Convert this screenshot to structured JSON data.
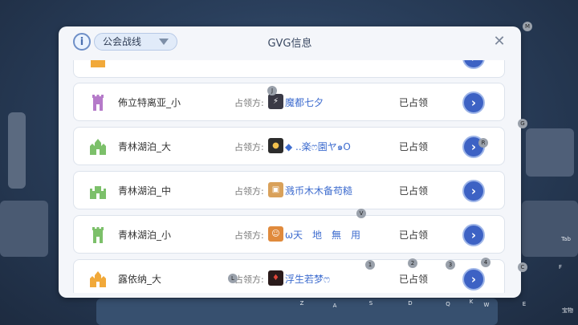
{
  "header": {
    "info_icon": "i",
    "dropdown_label": "公会战线",
    "title": "GVG信息",
    "close_icon": "✕"
  },
  "rows": [
    {
      "name": "",
      "occupier_label": "",
      "guild": "",
      "status": "",
      "castle_color": "#f1a93a",
      "emblem_color": "#f2c14e"
    },
    {
      "name": "佈立特离亚_小",
      "occupier_label": "占领方:",
      "guild": "魔都七夕",
      "status": "已占领",
      "castle_color": "#b57ac9",
      "emblem_color": "#3a3a46"
    },
    {
      "name": "青林湖泊_大",
      "occupier_label": "占领方:",
      "guild": "◆ ..楽ෆ園ヤ๑O",
      "status": "已占领",
      "castle_color": "#7cc06a",
      "emblem_color": "#2c2c2c"
    },
    {
      "name": "青林湖泊_中",
      "occupier_label": "占领方:",
      "guild": "溅币木木备苟糙",
      "status": "已占领",
      "castle_color": "#7cc06a",
      "emblem_color": "#d9a15a"
    },
    {
      "name": "青林湖泊_小",
      "occupier_label": "占领方:",
      "guild": "ω天　地　無　用",
      "status": "已占领",
      "castle_color": "#7cc06a",
      "emblem_color": "#e08a3c"
    },
    {
      "name": "露依纳_大",
      "occupier_label": "占领方:",
      "guild": "浮生若梦ෆ",
      "status": "已占领",
      "castle_color": "#f1a93a",
      "emblem_color": "#2a1b1b"
    }
  ],
  "hotkeys": {
    "m": "M",
    "g": "G",
    "r": "R",
    "j": "J",
    "v": "V",
    "l": "L",
    "k1": "1",
    "k2": "2",
    "k3": "3",
    "k4": "4",
    "c": "C",
    "f": "F",
    "tab": "Tab",
    "z": "Z",
    "a": "A",
    "s": "S",
    "d": "D",
    "q": "Q",
    "k": "K",
    "w": "W",
    "e": "E",
    "bottom_right": "宝物"
  }
}
